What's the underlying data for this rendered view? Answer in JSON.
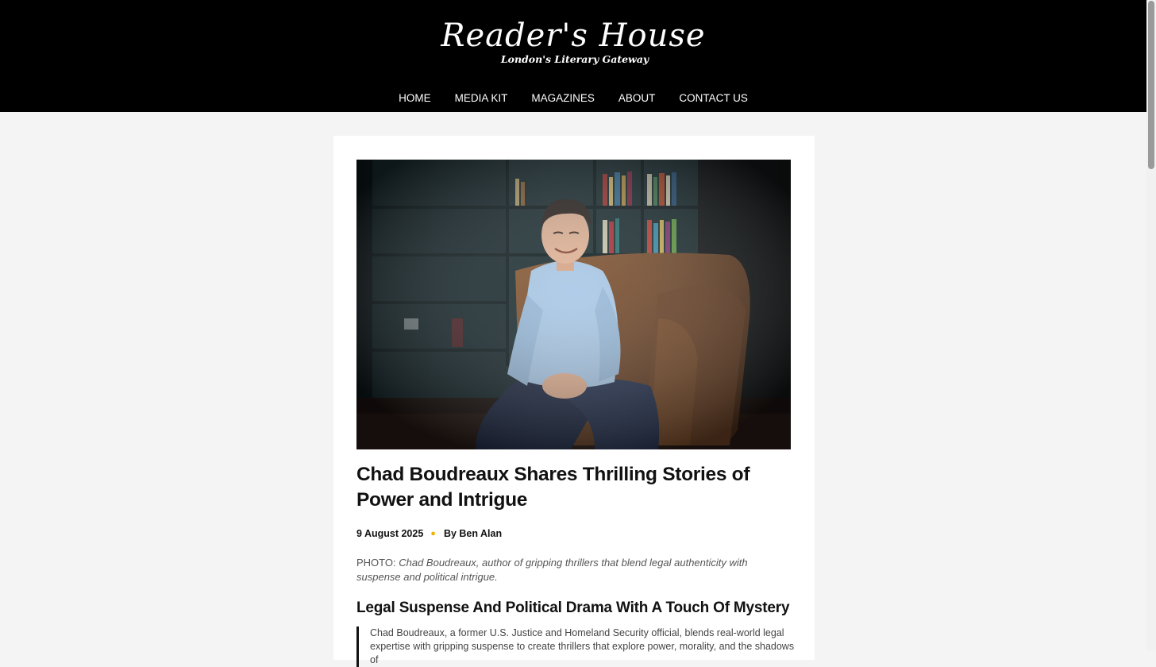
{
  "site": {
    "title": "Reader's House",
    "tagline": "London's Literary Gateway"
  },
  "nav": {
    "items": [
      "HOME",
      "MEDIA KIT",
      "MAGAZINES",
      "ABOUT",
      "CONTACT US"
    ]
  },
  "article": {
    "title": "Chad Boudreaux Shares Thrilling Stories of Power and Intrigue",
    "date": "9 August 2025",
    "author": "By Ben Alan",
    "caption_prefix": "PHOTO:",
    "caption_text": "Chad Boudreaux, author of gripping thrillers that blend legal authenticity with suspense and political intrigue.",
    "subheading": "Legal Suspense And Political Drama With A Touch Of Mystery",
    "intro": "Chad Boudreaux, a former U.S. Justice and Homeland Security official, blends real-world legal expertise with gripping suspense to create thrillers that explore power, morality, and the shadows of"
  },
  "colors": {
    "header_bg": "#000000",
    "accent_dot": "#f0b400",
    "page_bg": "#f4f4f4"
  }
}
